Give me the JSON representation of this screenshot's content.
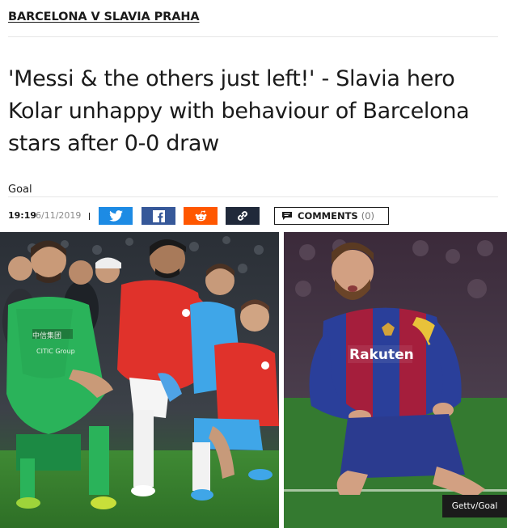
{
  "breadcrumb": {
    "label": "BARCELONA V SLAVIA PRAHA"
  },
  "article": {
    "headline": "'Messi & the others just left!' - Slavia hero Kolar unhappy with behaviour of Barcelona stars after 0-0 draw",
    "author": "Goal",
    "time": "19:19",
    "date": "6/11/2019"
  },
  "share": {
    "buttons": [
      {
        "name": "twitter",
        "icon": "twitter-icon",
        "color": "#1d8be4"
      },
      {
        "name": "facebook",
        "icon": "facebook-icon",
        "color": "#365899"
      },
      {
        "name": "reddit",
        "icon": "reddit-icon",
        "color": "#ff5700"
      },
      {
        "name": "link",
        "icon": "link-icon",
        "color": "#20293a"
      }
    ]
  },
  "comments": {
    "label": "COMMENTS",
    "count": "(0)",
    "icon": "comment-bubble-icon"
  },
  "image": {
    "credit": "Gettv/Goal",
    "left_shirt_sponsor": "中信集团 CITIC Group",
    "right_shirt_sponsor": "Rakuten"
  }
}
